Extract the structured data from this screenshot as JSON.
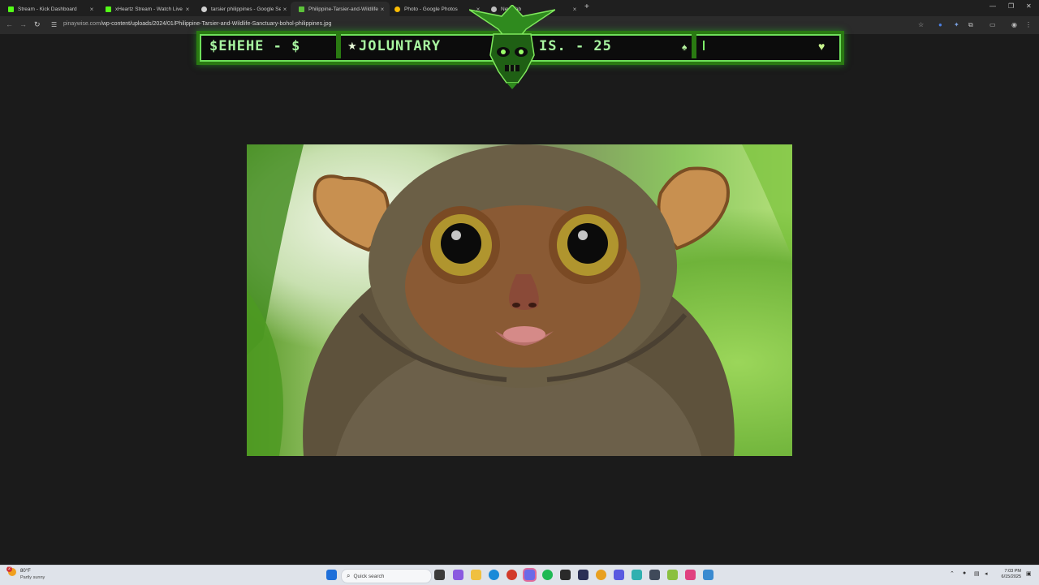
{
  "tabs": [
    {
      "title": "Stream - Kick Dashboard",
      "favicon_color": "#53fc18",
      "active": false
    },
    {
      "title": "xHeartz Stream - Watch Live on",
      "favicon_color": "#53fc18",
      "active": false
    },
    {
      "title": "tarsier philippines - Google Se",
      "favicon_color": "#d0d0d0",
      "active": false
    },
    {
      "title": "Philippine-Tarsier-and-Wildlife",
      "favicon_color": "#5cc23a",
      "active": true
    },
    {
      "title": "Photo - Google Photos",
      "favicon_color": "#fbbc04",
      "active": false
    },
    {
      "title": "New Tab",
      "favicon_color": "#bdbdbd",
      "active": false
    }
  ],
  "toolbar": {
    "url_lead": "pinaywise.com",
    "url_rest": "/wp-content/uploads/2024/01/Philippine-Tarsier-and-Wildlife-Sanctuary-bohol-philippines.jpg"
  },
  "banner": {
    "left_text": "$EHEHE - $",
    "mid_text": "JOLUNTARY",
    "right_text": "IS. - 25",
    "accent_color": "#6ee05a"
  },
  "photo": {
    "subject": "tarsier"
  },
  "taskbar": {
    "weather_badge": "2",
    "weather_temp": "80°F",
    "weather_desc": "Partly sunny",
    "search_label": "Quick search",
    "time": "7:03 PM",
    "date": "6/15/2025"
  }
}
